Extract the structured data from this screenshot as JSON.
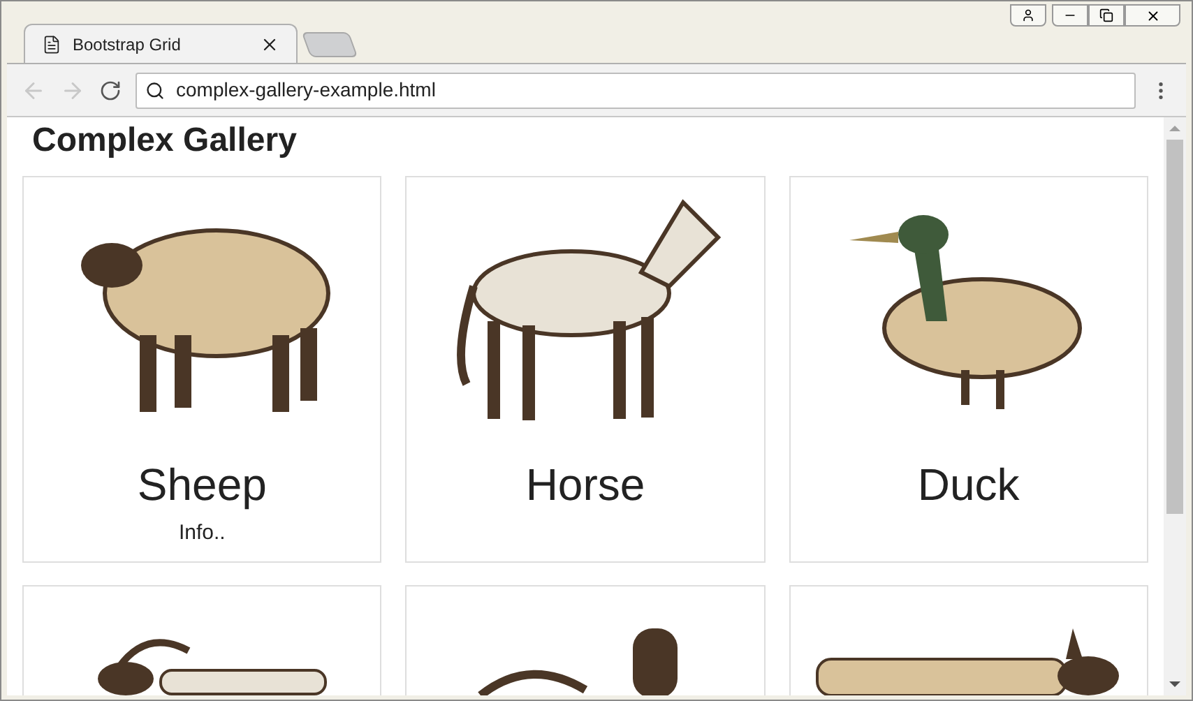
{
  "tab": {
    "title": "Bootstrap Grid",
    "selected": true
  },
  "address_bar": {
    "value": "complex-gallery-example.html"
  },
  "page": {
    "heading": "Complex Gallery",
    "cards": [
      {
        "kind": "sheep",
        "title": "Sheep",
        "text": "Info.."
      },
      {
        "kind": "horse",
        "title": "Horse"
      },
      {
        "kind": "duck",
        "title": "Duck"
      },
      {
        "kind": "goat"
      },
      {
        "kind": "rooster"
      },
      {
        "kind": "cow"
      }
    ]
  }
}
